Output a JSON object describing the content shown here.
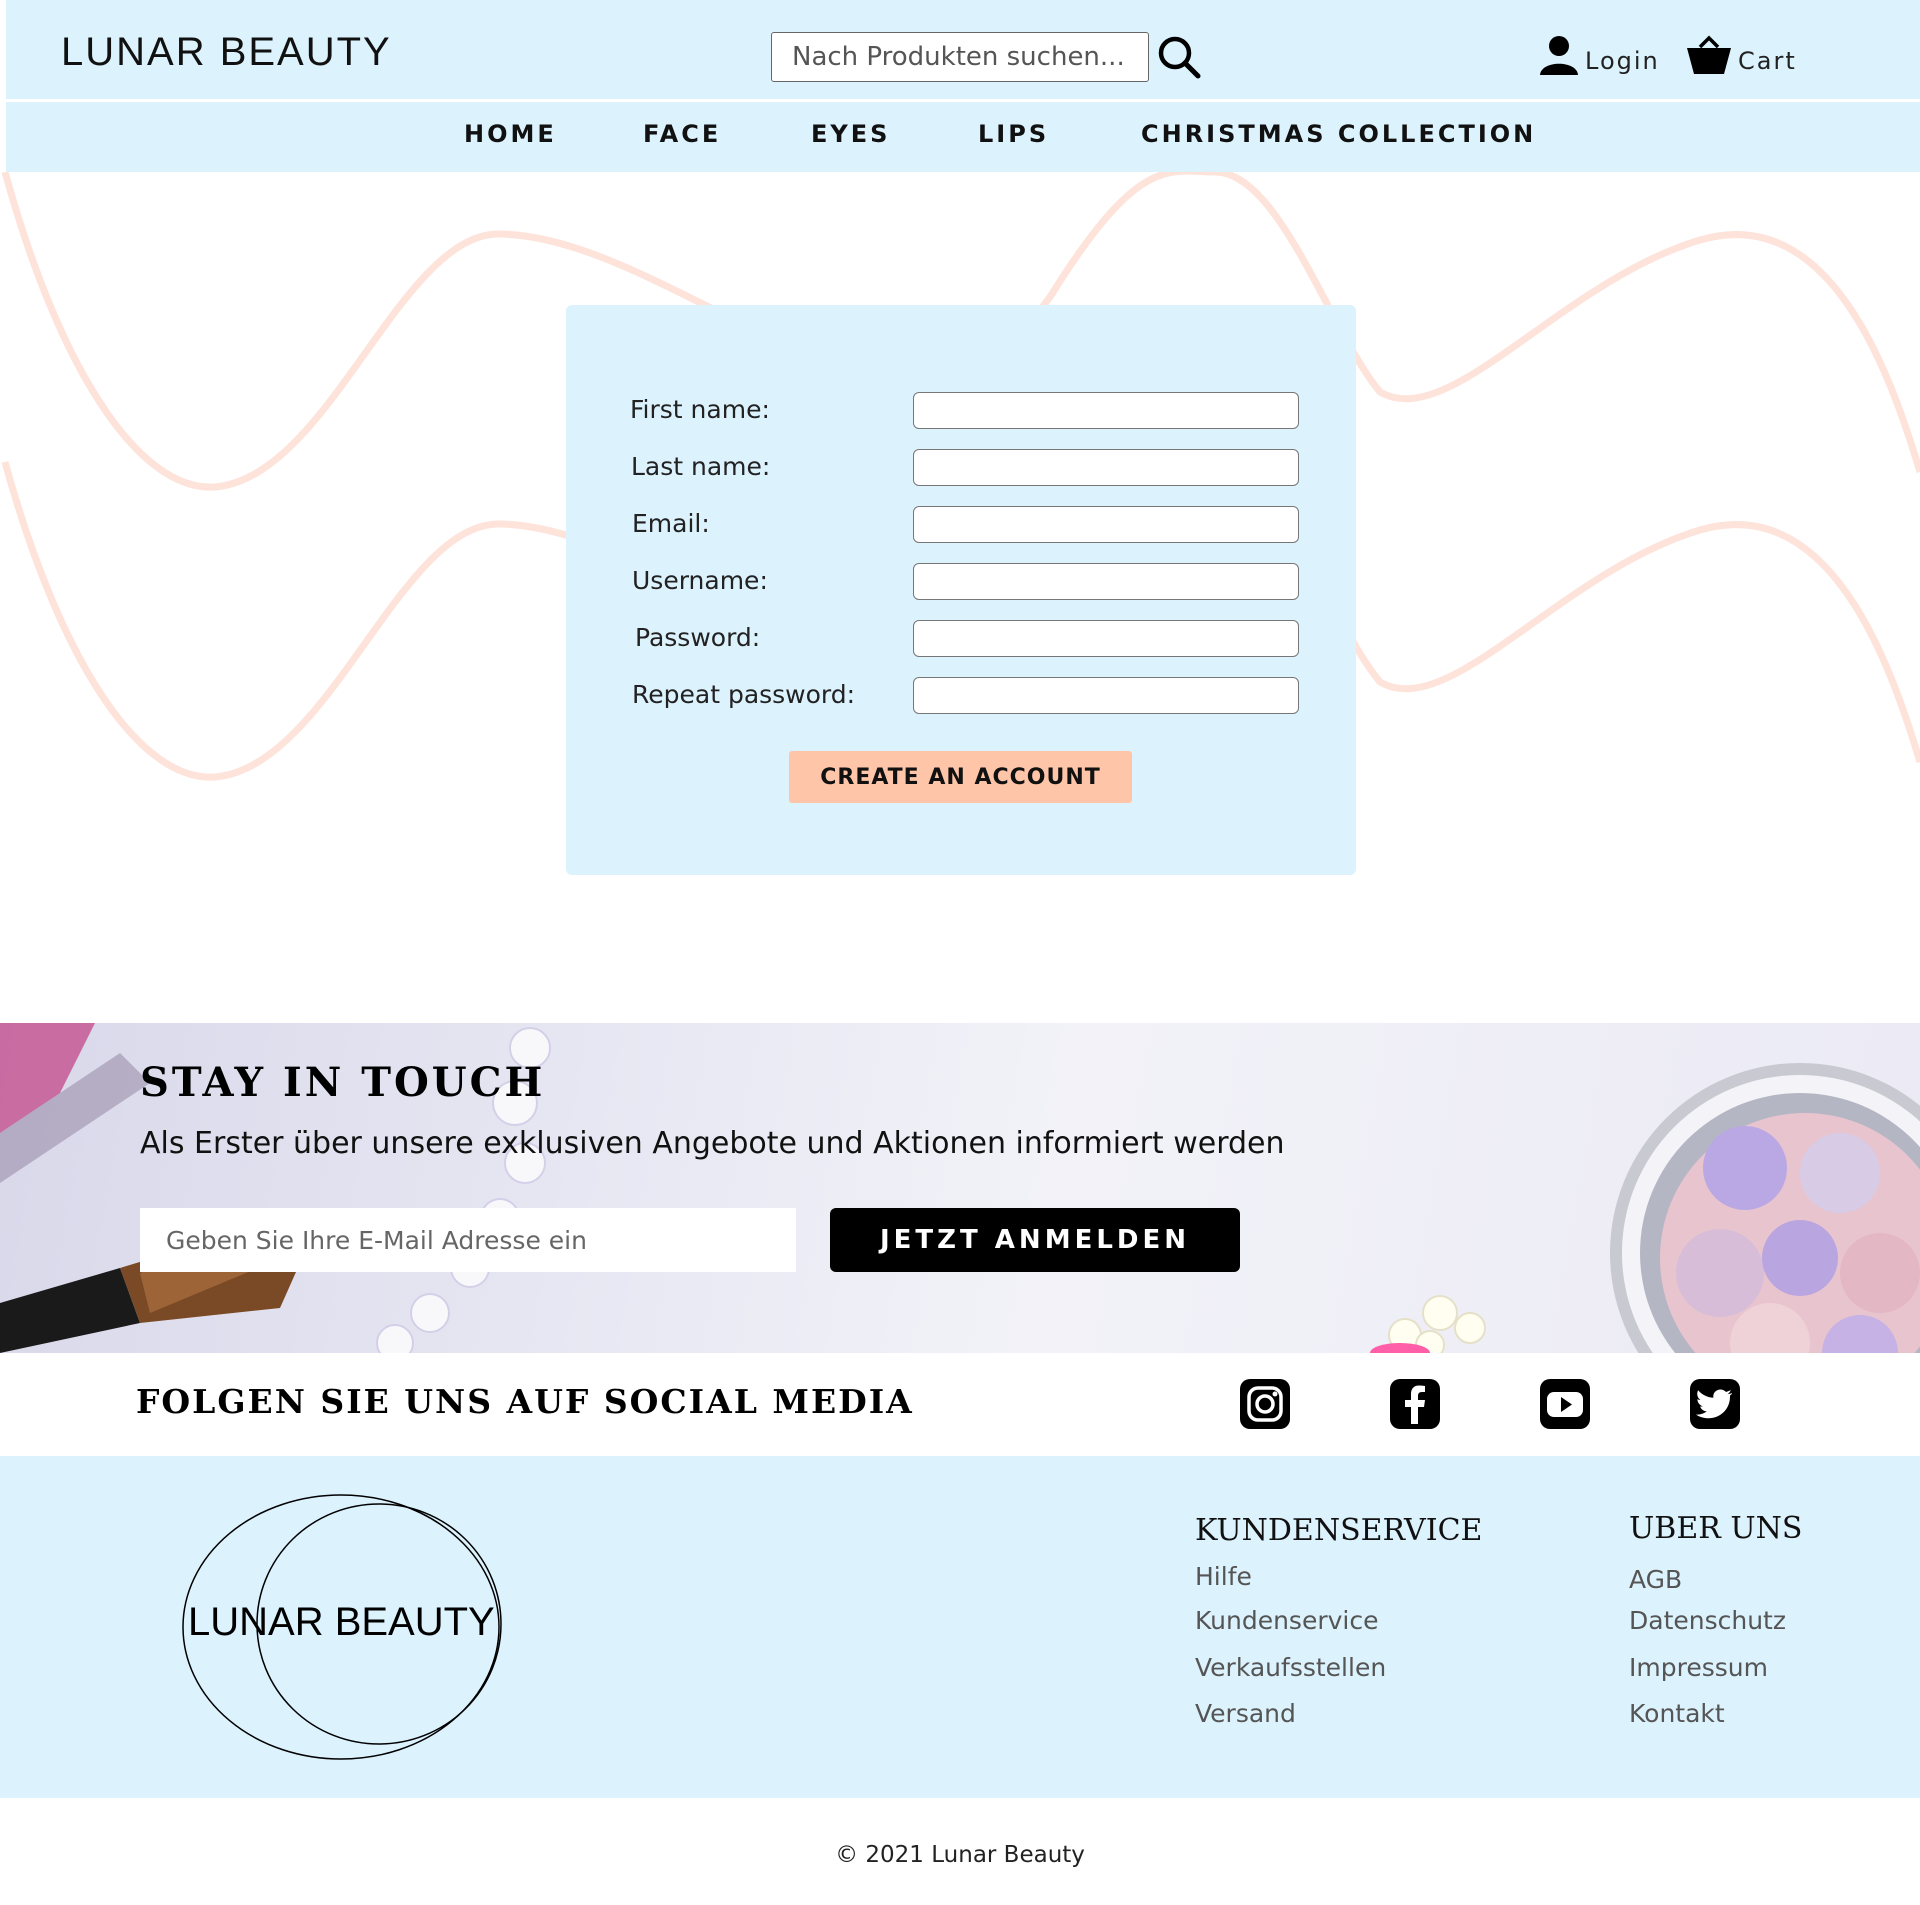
{
  "header": {
    "brand": "LUNAR BEAUTY",
    "search_placeholder": "Nach Produkten suchen...",
    "login_label": "Login",
    "cart_label": "Cart"
  },
  "nav": {
    "home": "HOME",
    "face": "FACE",
    "eyes": "EYES",
    "lips": "LIPS",
    "christmas": "CHRISTMAS COLLECTION"
  },
  "form": {
    "fields": [
      {
        "label": "First name:",
        "value": ""
      },
      {
        "label": "Last name:",
        "value": ""
      },
      {
        "label": "Email:",
        "value": ""
      },
      {
        "label": "Username:",
        "value": ""
      },
      {
        "label": "Password:",
        "value": ""
      },
      {
        "label": "Repeat password:",
        "value": ""
      }
    ],
    "submit_label": "CREATE AN ACCOUNT"
  },
  "newsletter": {
    "title": "STAY IN TOUCH",
    "subtitle": "Als Erster über unsere exklusiven Angebote und Aktionen informiert werden",
    "email_placeholder": "Geben Sie Ihre E-Mail Adresse ein",
    "button_label": "JETZT ANMELDEN"
  },
  "social": {
    "title": "FOLGEN SIE UNS AUF SOCIAL MEDIA",
    "icons": [
      "instagram-icon",
      "facebook-icon",
      "youtube-icon",
      "twitter-icon"
    ]
  },
  "footer": {
    "logo_text": "LUNAR BEAUTY",
    "kundenservice": {
      "heading": "KUNDENSERVICE",
      "links": [
        "Hilfe",
        "Kundenservice",
        "Verkaufsstellen",
        "Versand"
      ]
    },
    "ueber_uns": {
      "heading": "UBER UNS",
      "links": [
        "AGB",
        "Datenschutz",
        "Impressum",
        "Kontakt"
      ]
    },
    "copyright": "© 2021 Lunar Beauty"
  },
  "colors": {
    "header_bg": "#dcf2fd",
    "accent_button": "#ffc5a9",
    "wave": "#fde3da",
    "dark_button": "#000000"
  }
}
